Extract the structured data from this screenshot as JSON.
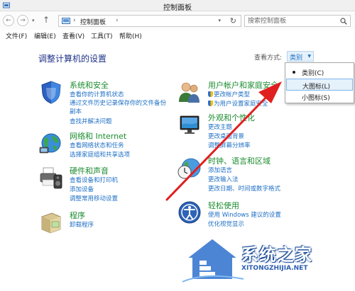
{
  "window": {
    "title": "控制面板"
  },
  "address": {
    "back_glyph": "←",
    "forward_glyph": "→",
    "dropdown_glyph": "▾",
    "up_glyph": "↑",
    "separator": "›",
    "location": "控制面板",
    "refresh_glyph": "↻",
    "search_placeholder": "搜索控制面板"
  },
  "menu": {
    "file": "文件(F)",
    "edit": "编辑(E)",
    "view": "查看(V)",
    "tools": "工具(T)",
    "help": "帮助(H)"
  },
  "content": {
    "title": "调整计算机的设置",
    "view_by_label": "查看方式:",
    "view_by_value": "类别",
    "view_by_caret": "▼"
  },
  "dropdown": {
    "options": [
      "类别(C)",
      "大图标(L)",
      "小图标(S)"
    ],
    "selected": "类别(C)",
    "highlighted": "大图标(L)"
  },
  "categories": {
    "system": {
      "title": "系统和安全",
      "links": [
        "查看你的计算机状态",
        "通过文件历史记录保存你的文件备份",
        "副本",
        "查找并解决问题"
      ]
    },
    "network": {
      "title": "网络和 Internet",
      "links": [
        "查看网络状态和任务",
        "选择家庭组和共享选项"
      ]
    },
    "hardware": {
      "title": "硬件和声音",
      "links": [
        "查看设备和打印机",
        "添加设备",
        "调整常用移动设置"
      ]
    },
    "programs": {
      "title": "程序",
      "links": [
        "卸载程序"
      ]
    },
    "users": {
      "title": "用户帐户和家庭安全",
      "links": [
        "更改帐户类型",
        "为用户设置家庭安全"
      ]
    },
    "appearance": {
      "title": "外观和个性化",
      "links": [
        "更改主题",
        "更改桌面背景",
        "调整屏幕分辨率"
      ]
    },
    "clock": {
      "title": "时钟、语言和区域",
      "links": [
        "添加语言",
        "更改输入法",
        "更改日期、时间或数字格式"
      ]
    },
    "ease": {
      "title": "轻松使用",
      "links": [
        "使用 Windows 建议的设置",
        "优化视觉显示"
      ]
    }
  },
  "watermark": {
    "text": "系统之家",
    "url": "XITONGZHIJIA.NET"
  },
  "colors": {
    "category_title": "#1a8c2d",
    "link": "#1e6fc5",
    "page_title": "#1e3287",
    "arrow": "#e02020",
    "highlight": "#e5f1fb"
  }
}
